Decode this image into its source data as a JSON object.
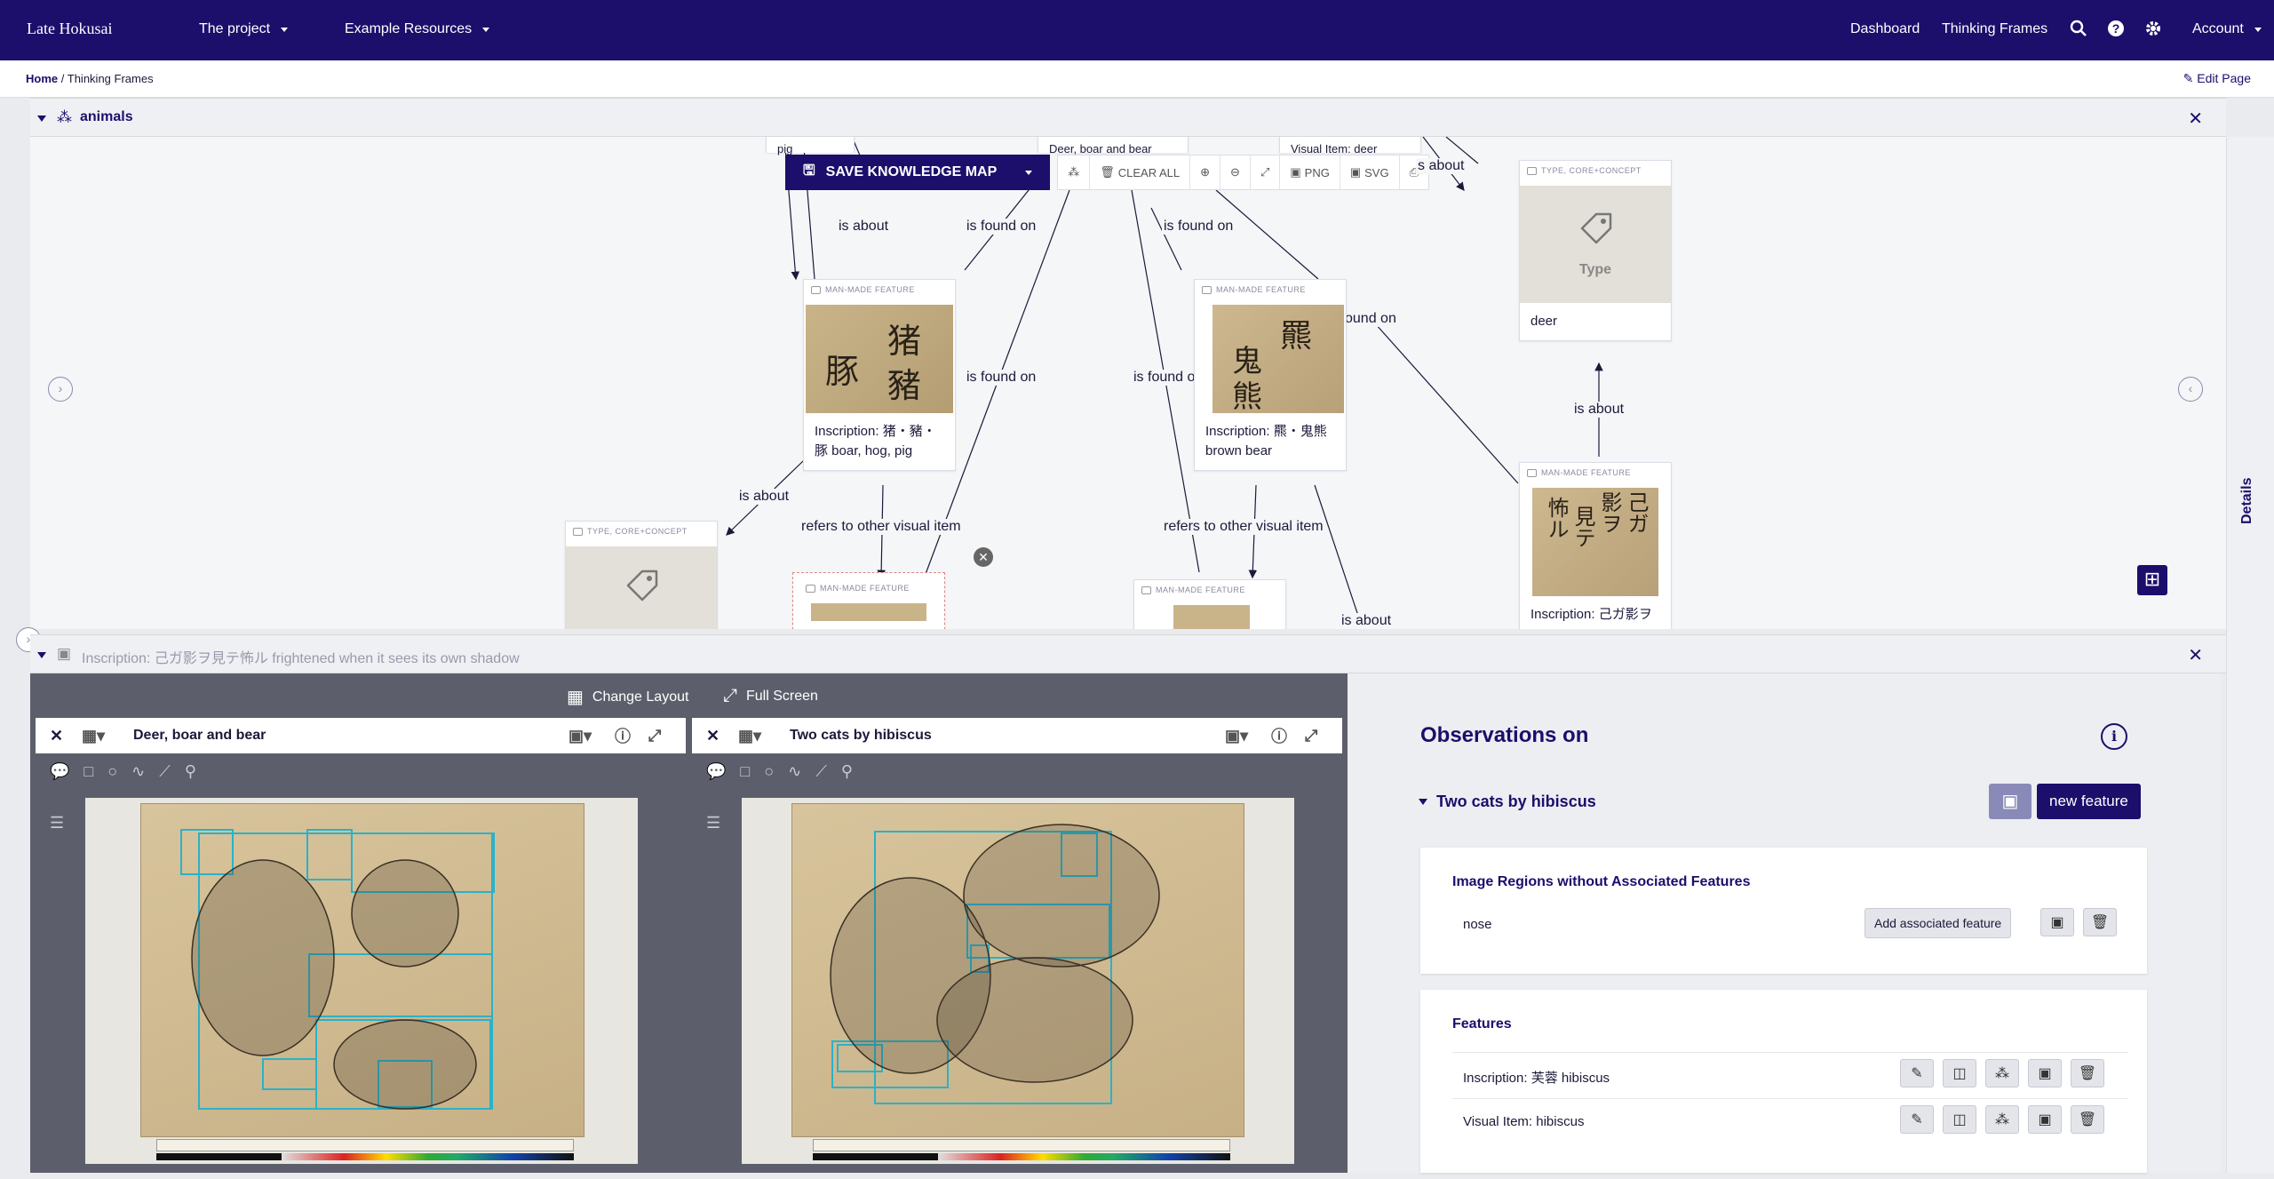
{
  "navbar": {
    "brand": "Late Hokusai",
    "menu": [
      "The project",
      "Example Resources"
    ],
    "right": [
      "Dashboard",
      "Thinking Frames"
    ],
    "account": "Account",
    "icons": [
      "search-icon",
      "help-icon",
      "gear-icon"
    ]
  },
  "breadcrumb": {
    "home": "Home",
    "sep": "/",
    "current": "Thinking Frames",
    "edit": "Edit Page"
  },
  "panel1": {
    "title": "animals"
  },
  "graph": {
    "toolbar": {
      "save": "SAVE KNOWLEDGE MAP",
      "clear": "CLEAR ALL",
      "png": "PNG",
      "svg": "SVG"
    },
    "top_clipped": [
      "pig",
      "Deer, boar and bear",
      "Visual Item: deer"
    ],
    "edges": [
      "is about",
      "is found on",
      "is found on",
      "s about",
      "is found on",
      "is found on",
      "ound on",
      "is about",
      "is about",
      "refers to other visual item",
      "refers to other visual item",
      "is about"
    ],
    "nodes": [
      {
        "type": "MAN-MADE FEATURE",
        "caption": "Inscription: 猪・豬・豚 boar, hog, pig",
        "glyphs": [
          "猪",
          "豬",
          "豚"
        ]
      },
      {
        "type": "MAN-MADE FEATURE",
        "caption": "Inscription: 羆・鬼熊 brown bear",
        "glyphs": [
          "羆",
          "鬼",
          "熊"
        ]
      },
      {
        "type": "TYPE, CORE+CONCEPT",
        "caption": "deer",
        "placeholder": "Type"
      },
      {
        "type": "MAN-MADE FEATURE",
        "caption": "Inscription: 己ガ影ヲ",
        "glyphs": [
          "己ガ",
          "影ヲ",
          "見テ",
          "怖ル"
        ]
      },
      {
        "type": "TYPE, CORE+CONCEPT",
        "caption": ""
      },
      {
        "type": "MAN-MADE FEATURE",
        "caption": ""
      },
      {
        "type": "MAN-MADE FEATURE",
        "caption": ""
      }
    ]
  },
  "panel2": {
    "title": "Inscription: 己ガ影ヲ見テ怖ル frightened when it sees its own shadow"
  },
  "layoutbar": {
    "change_layout": "Change Layout",
    "full_screen": "Full Screen"
  },
  "viewers": [
    {
      "title": "Deer, boar and bear"
    },
    {
      "title": "Two cats by hibiscus"
    }
  ],
  "observations": {
    "heading": "Observations on",
    "section": "Two cats by hibiscus",
    "new_feature": "new feature",
    "regions_title": "Image Regions without Associated Features",
    "regions": [
      {
        "name": "nose",
        "action": "Add associated feature"
      }
    ],
    "features_title": "Features",
    "features": [
      "Inscription: 芙蓉 hibiscus",
      "Visual Item: hibiscus"
    ]
  },
  "details_tab": "Details"
}
